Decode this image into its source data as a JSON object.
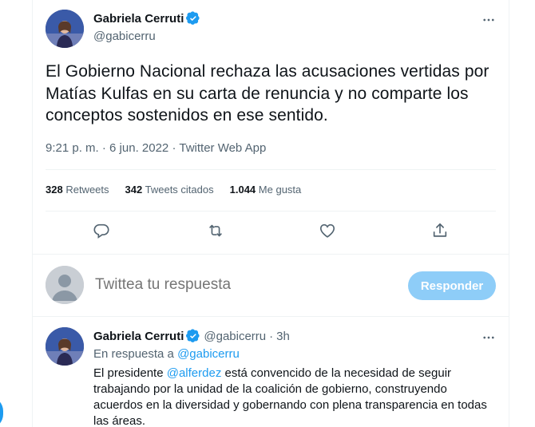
{
  "tweet": {
    "author_name": "Gabriela Cerruti",
    "author_handle": "@gabicerru",
    "text": "El Gobierno Nacional rechaza las acusaciones vertidas por Matías Kulfas en su carta de renuncia y no comparte los conceptos  sostenidos en ese sentido.",
    "time": "9:21 p. m.",
    "separator": "·",
    "date": "6 jun. 2022",
    "source": "Twitter Web App"
  },
  "stats": {
    "retweets_count": "328",
    "retweets_label": "Retweets",
    "quotes_count": "342",
    "quotes_label": "Tweets citados",
    "likes_count": "1.044",
    "likes_label": "Me gusta"
  },
  "compose": {
    "placeholder": "Twittea tu respuesta",
    "button_label": "Responder"
  },
  "reply": {
    "author_name": "Gabriela Cerruti",
    "author_handle": "@gabicerru",
    "separator": "·",
    "time": "3h",
    "in_reply_prefix": "En respuesta a",
    "in_reply_handle": "@gabicerru",
    "text_before": "El presidente",
    "mention": "@alferdez",
    "text_after": "está convencido de la necesidad de seguir trabajando por la unidad de la coalición de gobierno, construyendo acuerdos en la diversidad y gobernando con plena transparencia en todas las áreas."
  },
  "colors": {
    "accent": "#1d9bf0",
    "button_disabled": "#8ecdf8",
    "secondary_text": "#536471",
    "divider": "#eff3f4"
  },
  "icons": [
    "verified-badge-icon",
    "more-options-icon",
    "reply-icon",
    "retweet-icon",
    "like-icon",
    "share-icon",
    "default-avatar-icon"
  ]
}
